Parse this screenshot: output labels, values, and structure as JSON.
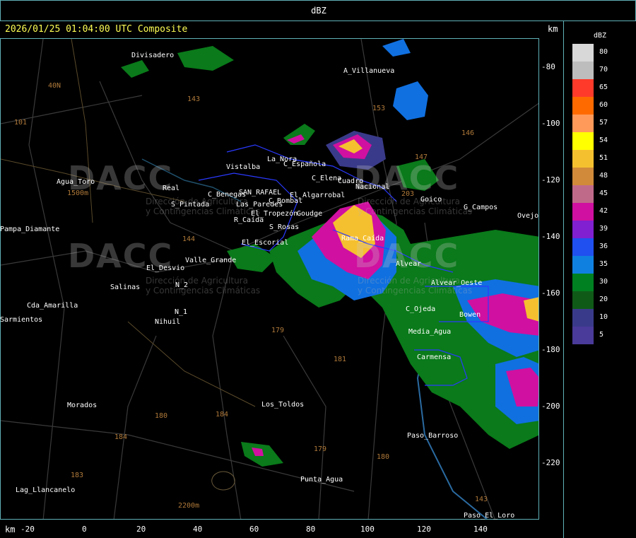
{
  "header": {
    "title": "dBZ",
    "timestamp": "2026/01/25 01:04:00 UTC Composite",
    "units_top": "km",
    "units_bottom": "km"
  },
  "legend": {
    "title": "dBZ",
    "entries": [
      {
        "value": "80",
        "color": "#d8d8d8"
      },
      {
        "value": "70",
        "color": "#bdbdbd"
      },
      {
        "value": "65",
        "color": "#ff3a2a"
      },
      {
        "value": "60",
        "color": "#ff6a00"
      },
      {
        "value": "57",
        "color": "#ff9a5a"
      },
      {
        "value": "54",
        "color": "#ffff00"
      },
      {
        "value": "51",
        "color": "#f5c030"
      },
      {
        "value": "48",
        "color": "#d08a3a"
      },
      {
        "value": "45",
        "color": "#c06a8a"
      },
      {
        "value": "42",
        "color": "#d010a0"
      },
      {
        "value": "39",
        "color": "#8020d0"
      },
      {
        "value": "36",
        "color": "#2050f0"
      },
      {
        "value": "35",
        "color": "#1080e0"
      },
      {
        "value": "30",
        "color": "#008020"
      },
      {
        "value": "20",
        "color": "#105a18"
      },
      {
        "value": "10",
        "color": "#3a3a8a"
      },
      {
        "value": "5",
        "color": "#4a3a9a"
      }
    ]
  },
  "y_axis": [
    "-80",
    "-100",
    "-120",
    "-140",
    "-160",
    "-180",
    "-200",
    "-220"
  ],
  "x_axis": [
    "-20",
    "0",
    "20",
    "40",
    "60",
    "80",
    "100",
    "120",
    "140"
  ],
  "places": [
    "Divisadero",
    "A_Villanueva",
    "Vistalba",
    "La_Nora",
    "C_Española",
    "C_Elena",
    "Cuadro",
    "Nacional",
    "Rama_Caída",
    "Goico",
    "G_Campos",
    "Ovejo",
    "Agua_Toro",
    "Pampa_Diamante",
    "Real",
    "S_Pintada",
    "C_Benegas",
    "SAN_RAFAEL",
    "Las_Paredes",
    "C_Bombal",
    "El_Algarrobal",
    "El_Tropezón",
    "Goudge",
    "R_Caída",
    "S_Rosas",
    "El_Escorial",
    "Valle_Grande",
    "El_Desvio",
    "Salinas",
    "N_2",
    "Cda_Amarilla",
    "Sarmientos",
    "N_1",
    "Nihuil",
    "Alvear",
    "C_Ojeda",
    "Media_Agua",
    "Bowen",
    "Carmensa",
    "Morados",
    "Los_Toldos",
    "Paso_Barroso",
    "Punta_Agua",
    "Lag_Llancanelo",
    "Paso_El_Loro",
    "Alvear_Oeste"
  ],
  "elevations": [
    "101",
    "40N",
    "143",
    "153",
    "146",
    "147",
    "203",
    "144",
    "179",
    "181",
    "184",
    "180",
    "179",
    "184",
    "183",
    "180",
    "143",
    "2200m",
    "1500m"
  ],
  "watermark": {
    "brand": "DACC",
    "line1": "Dirección de Agricultura",
    "line2": "y Contingencias Climáticas"
  }
}
